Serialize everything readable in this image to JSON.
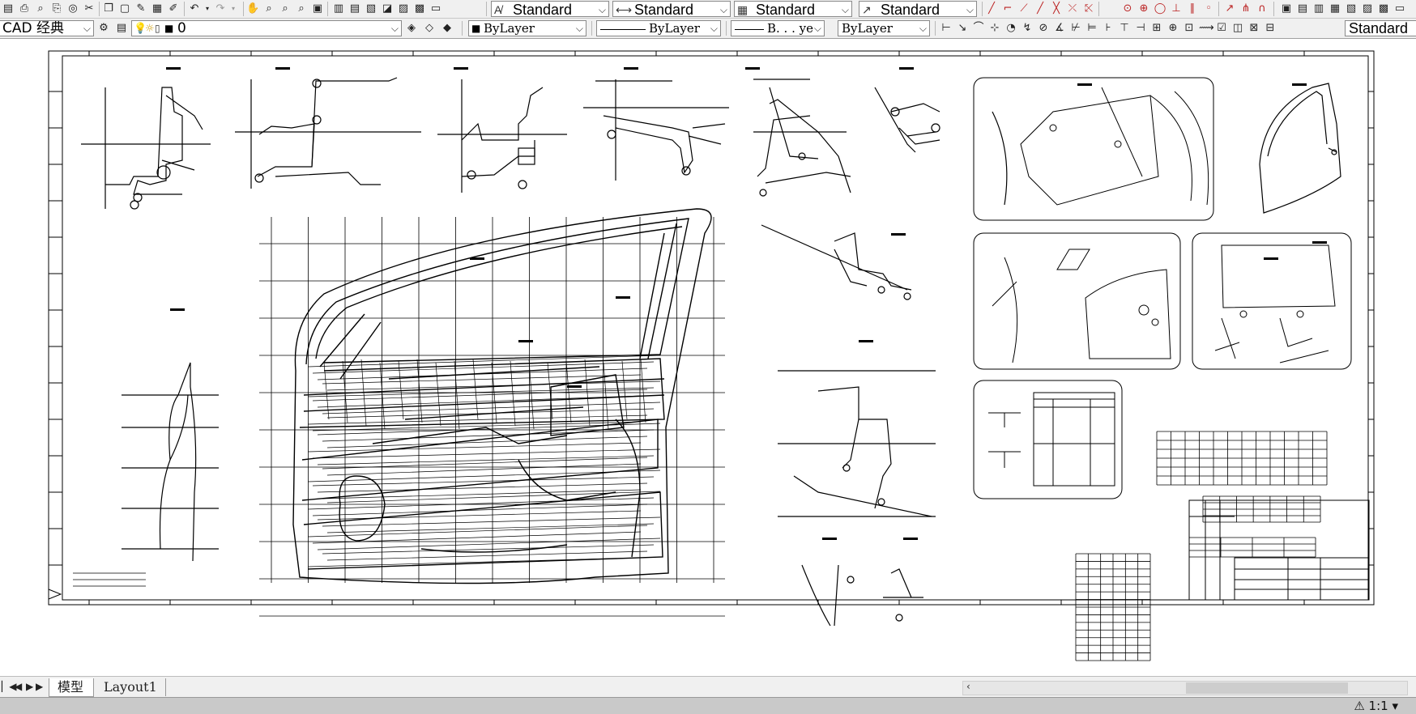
{
  "toolbar1": {
    "text_style": "Standard",
    "dim_style": "Standard",
    "table_style": "Standard",
    "multileader_style": "Standard"
  },
  "toolbar2": {
    "workspace": "CAD 经典",
    "layer": "0",
    "color": "ByLayer",
    "linetype": "ByLayer",
    "lineweight": "B. . . ye",
    "plotstyle": "ByLayer",
    "dim_style_right": "Standard"
  },
  "layout_tabs": {
    "model": "模型",
    "layout1": "Layout1"
  },
  "status": {
    "annotation_scale": "1:1"
  }
}
